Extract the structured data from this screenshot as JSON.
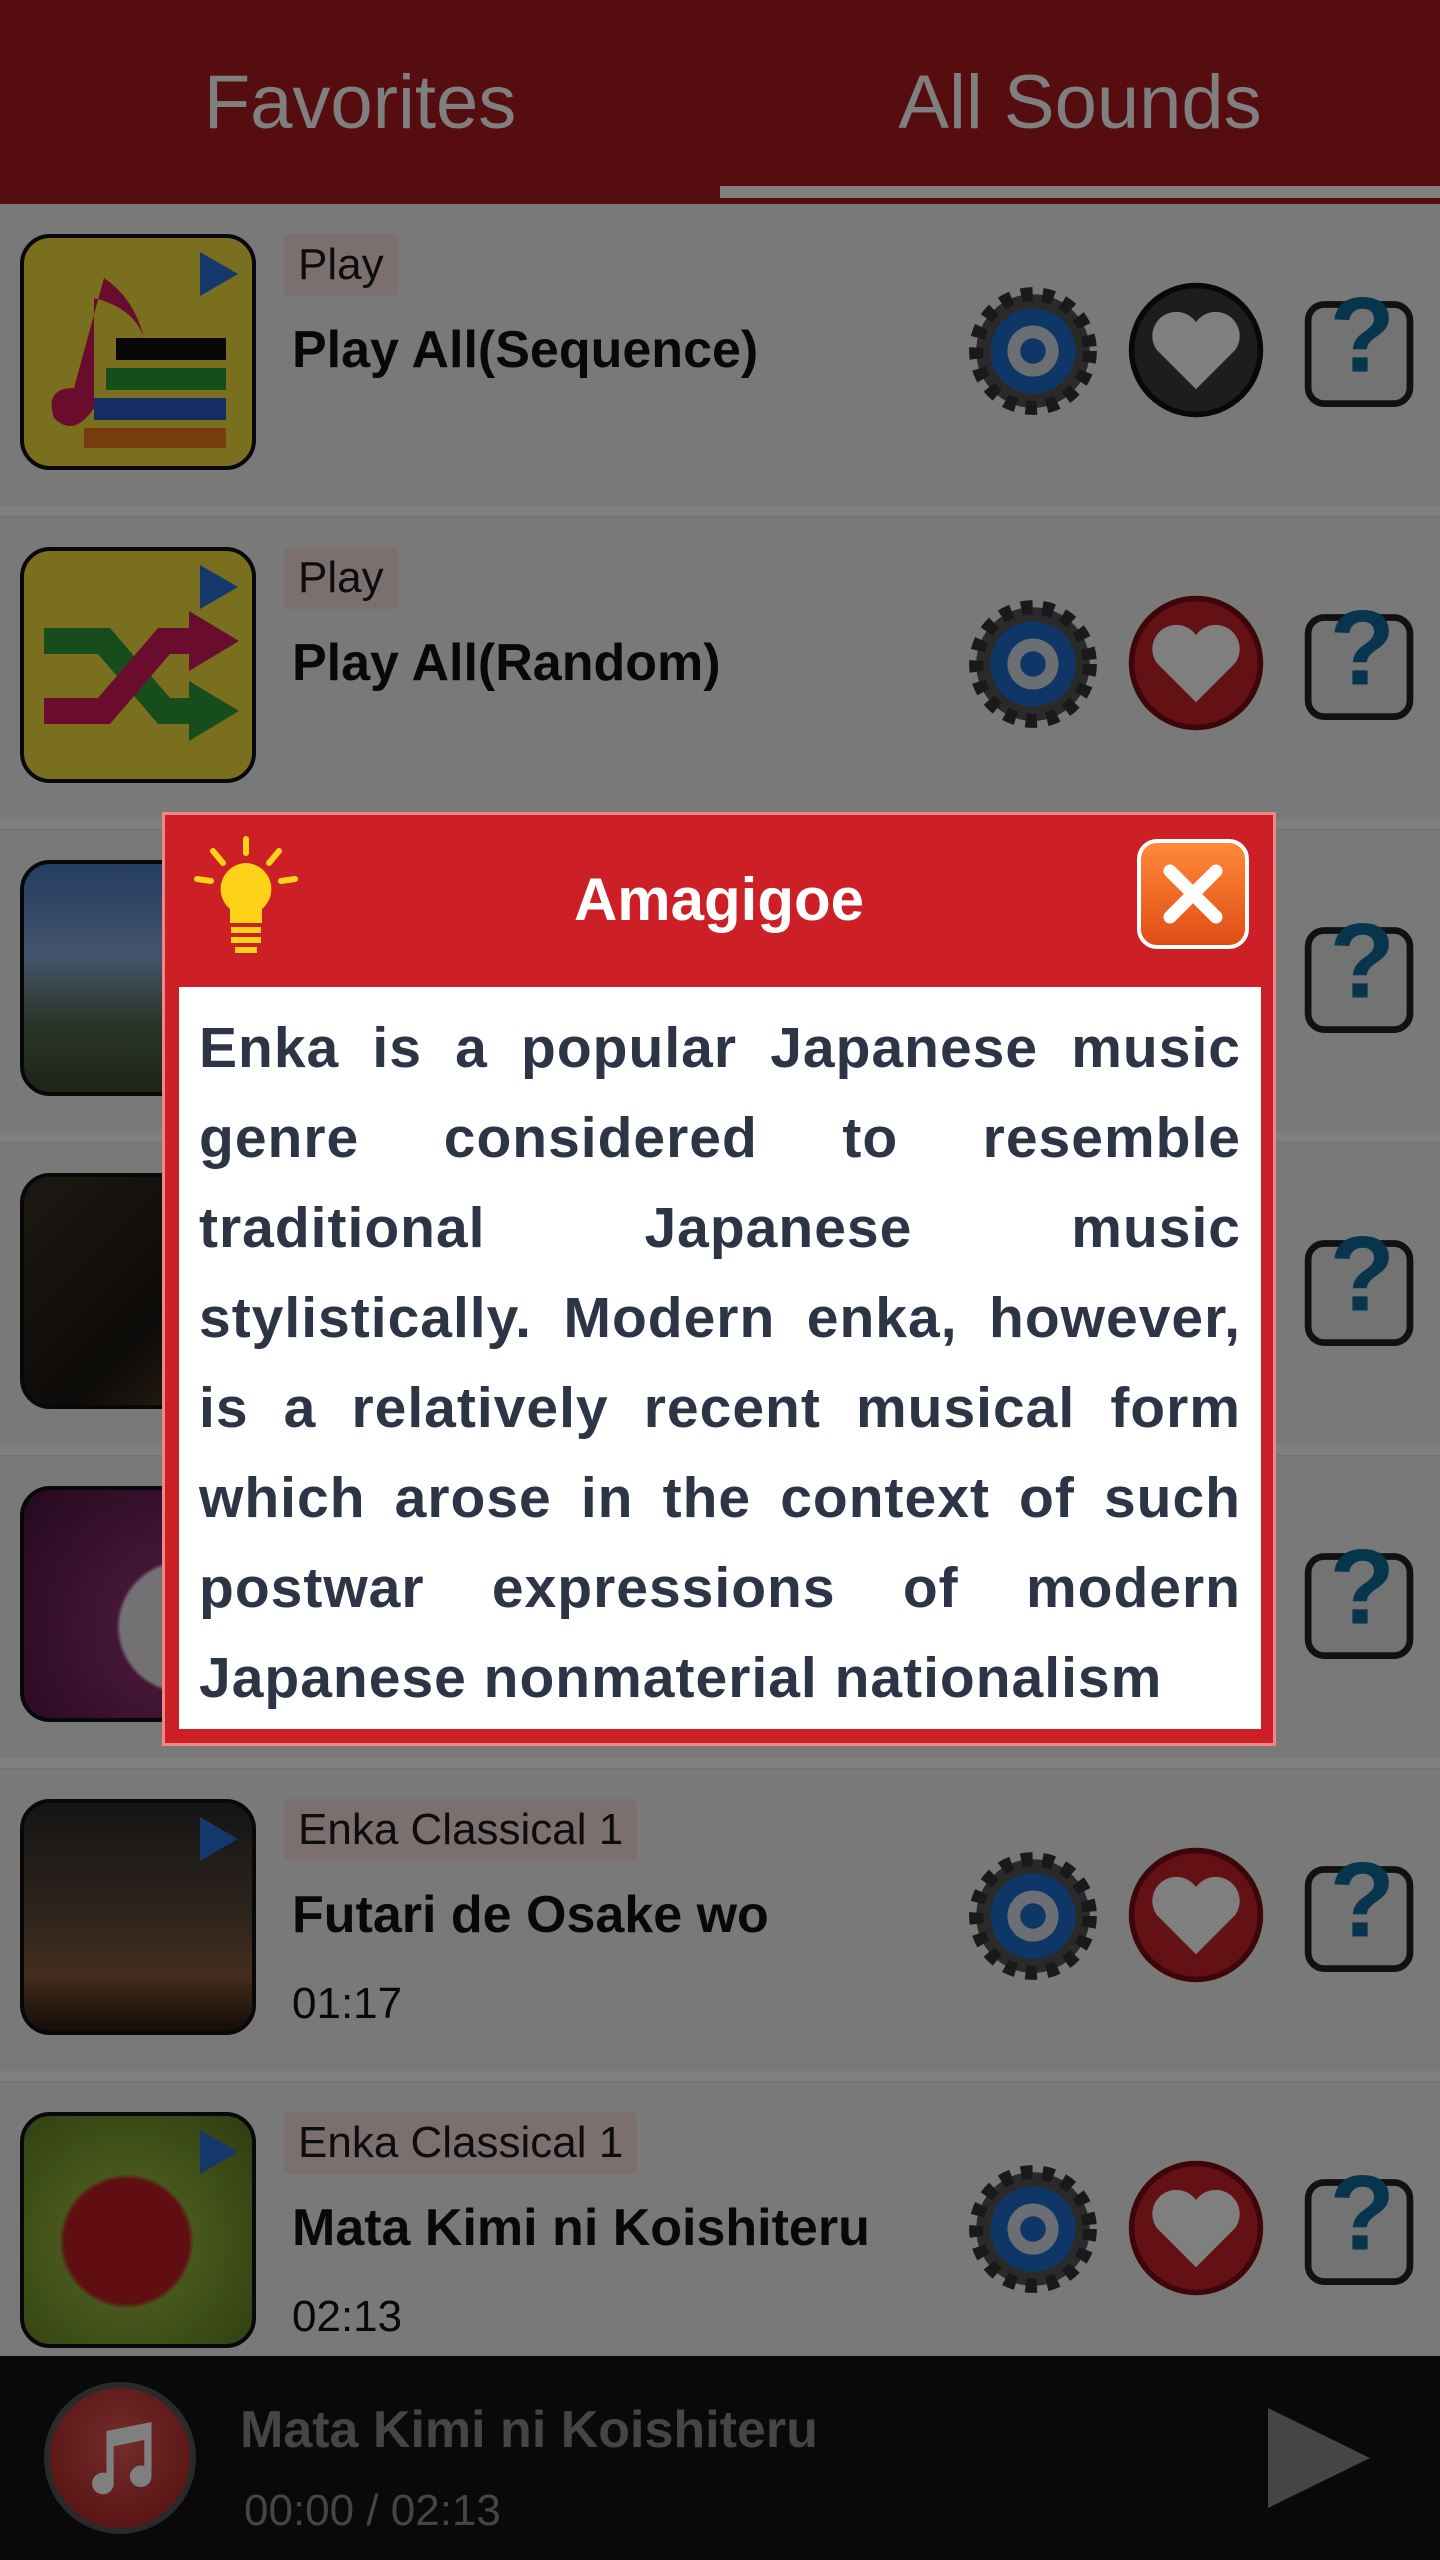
{
  "tabs": [
    {
      "label": "Favorites",
      "active": false
    },
    {
      "label": "All Sounds",
      "active": true
    }
  ],
  "rows": [
    {
      "category": "Play",
      "title": "Play All(Sequence)",
      "duration": "",
      "thumb": "music-sequence-icon",
      "favorite": false
    },
    {
      "category": "Play",
      "title": "Play All(Random)",
      "duration": "",
      "thumb": "shuffle-icon",
      "favorite": true
    },
    {
      "category": "",
      "title": "",
      "duration": "",
      "thumb": "mountain-photo",
      "favorite": true
    },
    {
      "category": "",
      "title": "",
      "duration": "",
      "thumb": "bar-interior-photo",
      "favorite": true
    },
    {
      "category": "",
      "title": "",
      "duration": "",
      "thumb": "pocket-watch-photo",
      "favorite": true
    },
    {
      "category": "Enka Classical 1",
      "title": "Futari de Osake wo",
      "duration": "01:17",
      "thumb": "sake-glass-photo",
      "favorite": true
    },
    {
      "category": "Enka Classical 1",
      "title": "Mata Kimi ni Koishiteru",
      "duration": "02:13",
      "thumb": "broken-heart-photo",
      "favorite": true
    }
  ],
  "dialog": {
    "title": "Amagigoe",
    "body": "Enka is a popular Japanese music genre considered to resemble traditional Japanese music stylistically. Modern enka, however, is a relatively recent musical form which arose in the context of such postwar expressions of modern Japanese nonmaterial nationalism"
  },
  "player": {
    "title": "Mata Kimi ni Koishiteru",
    "time": "00:00 / 02:13"
  },
  "colors": {
    "brand_red": "#ad1a21",
    "dialog_red": "#cc1f26",
    "close_orange": "#f0641e",
    "heart_red": "#c8232a",
    "gear_blue": "#1d6fd1"
  }
}
